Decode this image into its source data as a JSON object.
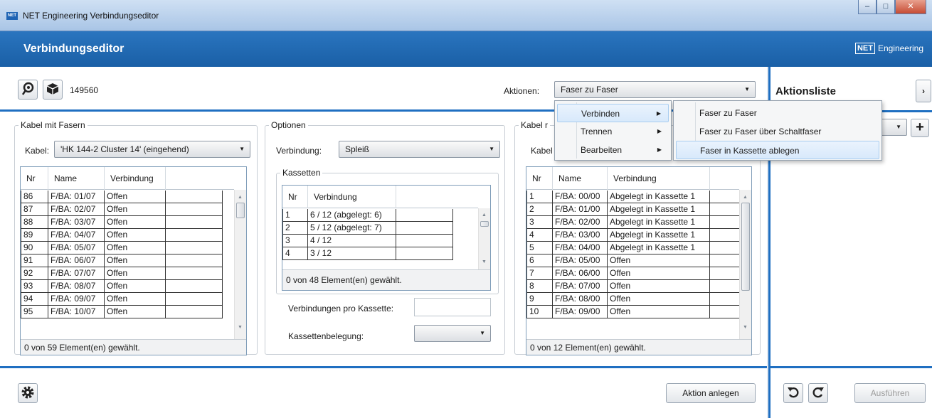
{
  "window": {
    "app_icon_text": "NET",
    "title": "NET Engineering Verbindungseditor"
  },
  "header": {
    "title": "Verbindungseditor",
    "brand_box": "NET",
    "brand_text": "Engineering"
  },
  "toolbar": {
    "id_value": "149560",
    "icons": [
      "fiber-icon",
      "cube-icon"
    ],
    "actions_label": "Aktionen:",
    "actions_value": "Faser zu Faser"
  },
  "left_panel": {
    "title": "Kabel mit Fasern",
    "cable_label": "Kabel:",
    "cable_value": "'HK 144-2 Cluster 14' (eingehend)",
    "columns": [
      "Nr",
      "Name",
      "Verbindung"
    ],
    "rows": [
      [
        "86",
        "F/BA: 01/07",
        "Offen"
      ],
      [
        "87",
        "F/BA: 02/07",
        "Offen"
      ],
      [
        "88",
        "F/BA: 03/07",
        "Offen"
      ],
      [
        "89",
        "F/BA: 04/07",
        "Offen"
      ],
      [
        "90",
        "F/BA: 05/07",
        "Offen"
      ],
      [
        "91",
        "F/BA: 06/07",
        "Offen"
      ],
      [
        "92",
        "F/BA: 07/07",
        "Offen"
      ],
      [
        "93",
        "F/BA: 08/07",
        "Offen"
      ],
      [
        "94",
        "F/BA: 09/07",
        "Offen"
      ],
      [
        "95",
        "F/BA: 10/07",
        "Offen"
      ]
    ],
    "footer": "0 von 59 Element(en) gewählt."
  },
  "options_panel": {
    "title": "Optionen",
    "connection_label": "Verbindung:",
    "connection_value": "Spleiß",
    "cassettes_title": "Kassetten",
    "cassette_columns": [
      "Nr",
      "Verbindung"
    ],
    "cassette_rows": [
      [
        "1",
        "6 / 12 (abgelegt: 6)"
      ],
      [
        "2",
        "5 / 12 (abgelegt: 7)"
      ],
      [
        "3",
        "4 / 12"
      ],
      [
        "4",
        "3 / 12"
      ]
    ],
    "cassette_footer": "0 von 48 Element(en) gewählt.",
    "per_cassette_label": "Verbindungen pro Kassette:",
    "per_cassette_value": "",
    "occupancy_label": "Kassettenbelegung:",
    "occupancy_value": ""
  },
  "right_panel": {
    "title": "Kabel r",
    "cable_label": "Kabel",
    "columns": [
      "Nr",
      "Name",
      "Verbindung"
    ],
    "rows": [
      [
        "1",
        "F/BA: 00/00",
        "Abgelegt in Kassette 1"
      ],
      [
        "2",
        "F/BA: 01/00",
        "Abgelegt in Kassette 1"
      ],
      [
        "3",
        "F/BA: 02/00",
        "Abgelegt in Kassette 1"
      ],
      [
        "4",
        "F/BA: 03/00",
        "Abgelegt in Kassette 1"
      ],
      [
        "5",
        "F/BA: 04/00",
        "Abgelegt in Kassette 1"
      ],
      [
        "6",
        "F/BA: 05/00",
        "Offen"
      ],
      [
        "7",
        "F/BA: 06/00",
        "Offen"
      ],
      [
        "8",
        "F/BA: 07/00",
        "Offen"
      ],
      [
        "9",
        "F/BA: 08/00",
        "Offen"
      ],
      [
        "10",
        "F/BA: 09/00",
        "Offen"
      ]
    ],
    "footer": "0 von 12 Element(en) gewählt."
  },
  "actions_menu": {
    "items": [
      {
        "label": "Verbinden",
        "highlighted": true
      },
      {
        "label": "Trennen",
        "highlighted": false
      },
      {
        "label": "Bearbeiten",
        "highlighted": false
      }
    ],
    "submenu": [
      {
        "label": "Faser zu Faser",
        "highlighted": false
      },
      {
        "label": "Faser zu Faser über Schaltfaser",
        "highlighted": false
      },
      {
        "label": "Faser in Kassette ablegen",
        "highlighted": true
      }
    ]
  },
  "bottom": {
    "create_action_label": "Aktion anlegen"
  },
  "sidebar": {
    "title": "Aktionsliste",
    "combo_value": "",
    "execute_label": "Ausführen",
    "execute_enabled": false
  },
  "colors": {
    "accent": "#1f6fc1",
    "header": "#1a5fa6",
    "highlight": "#d8e9fb"
  }
}
